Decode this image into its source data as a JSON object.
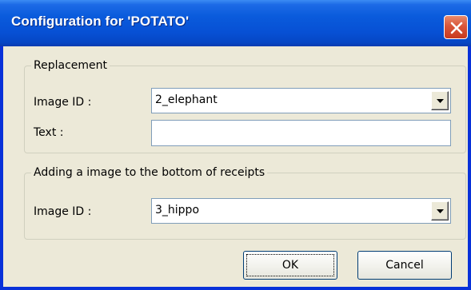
{
  "window": {
    "title": "Configuration for 'POTATO'"
  },
  "replacement": {
    "legend": "Replacement",
    "image_id_label": "Image  ID :",
    "image_id_value": "2_elephant",
    "text_label": "Text :",
    "text_value": ""
  },
  "bottom_image": {
    "legend": "Adding a image to the bottom of receipts",
    "image_id_label": "Image  ID :",
    "image_id_value": "3_hippo"
  },
  "buttons": {
    "ok": "OK",
    "cancel": "Cancel"
  },
  "icons": {
    "close": "close-icon",
    "dropdown": "chevron-down-icon"
  },
  "colors": {
    "titlebar": "#0a5bdc",
    "dialog_bg": "#ece9d8",
    "close_button": "#d9563a"
  }
}
